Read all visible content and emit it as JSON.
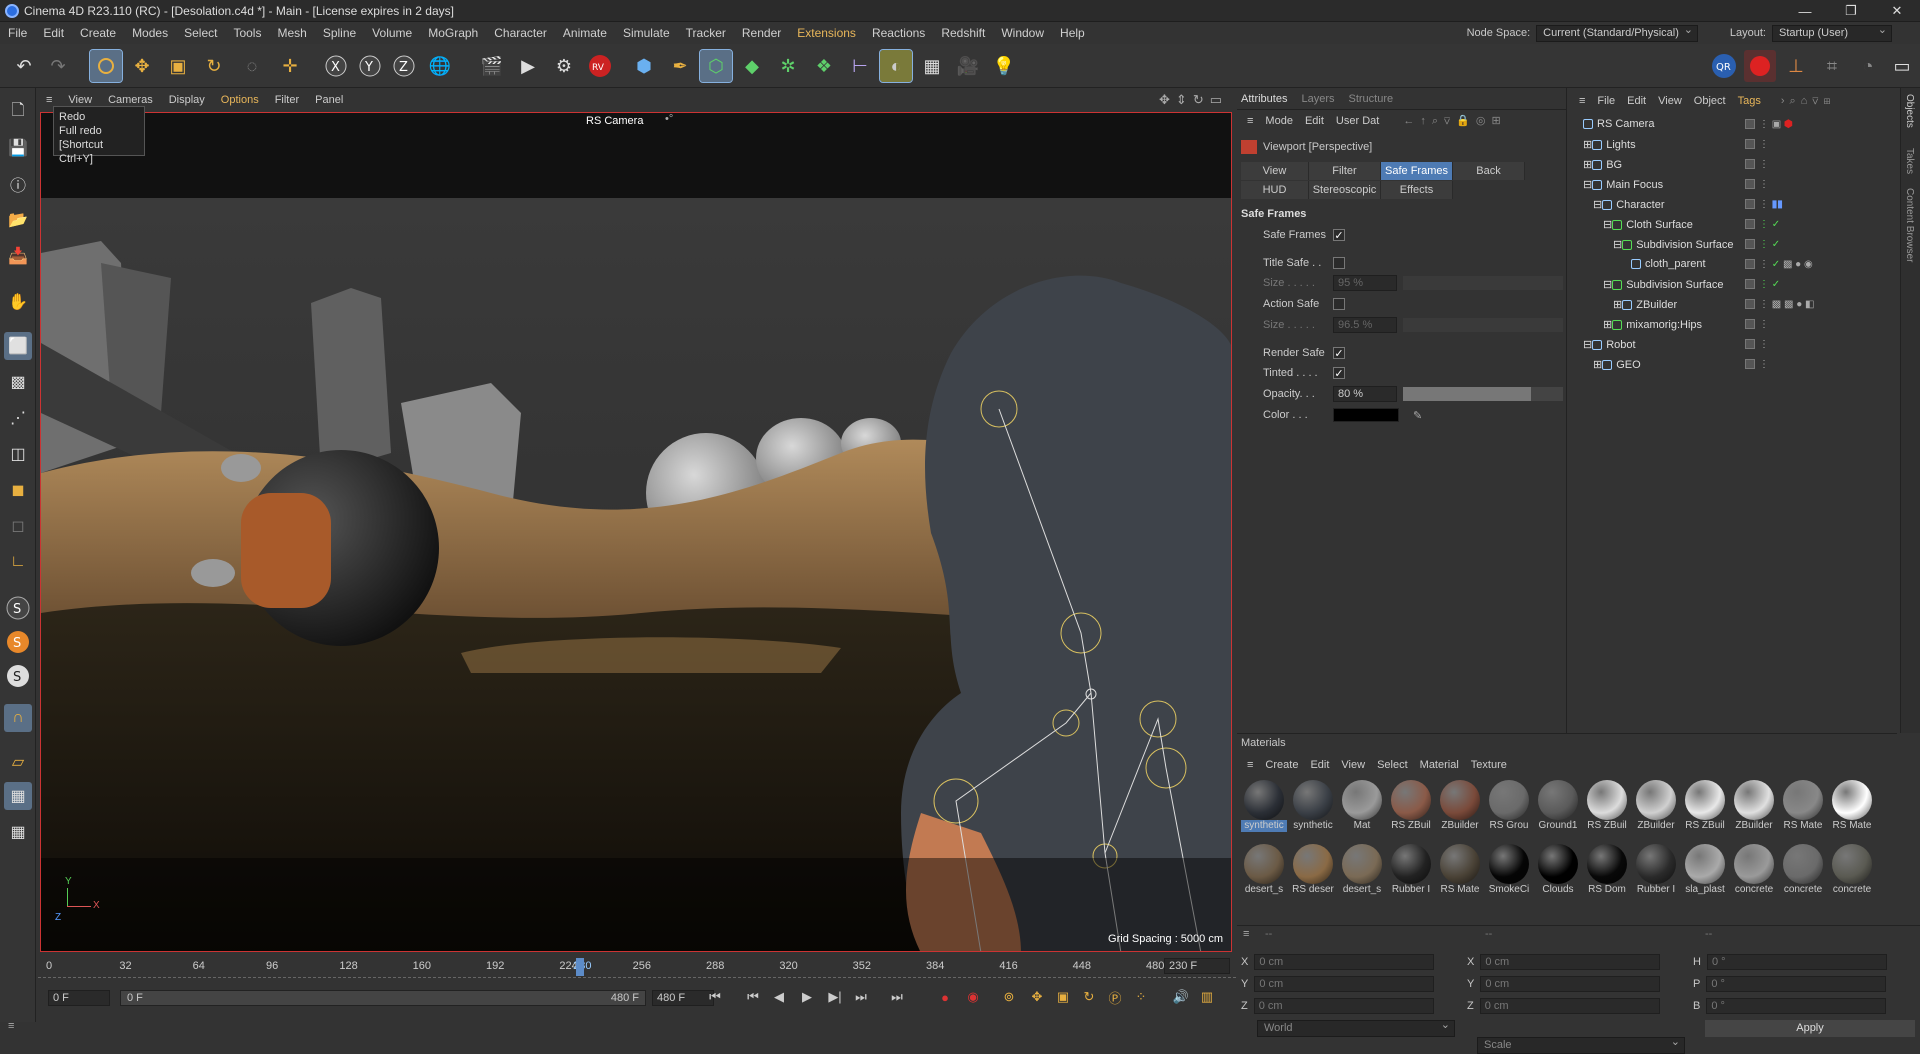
{
  "window": {
    "title": "Cinema 4D R23.110 (RC) - [Desolation.c4d *] - Main - [License expires in 2 days]",
    "controls": [
      "—",
      "❐",
      "✕"
    ]
  },
  "menu": {
    "items": [
      "File",
      "Edit",
      "Create",
      "Modes",
      "Select",
      "Tools",
      "Mesh",
      "Spline",
      "Volume",
      "MoGraph",
      "Character",
      "Animate",
      "Simulate",
      "Tracker",
      "Render",
      "Extensions",
      "Reactions",
      "Redshift",
      "Window",
      "Help"
    ],
    "node_space_label": "Node Space:",
    "node_space_value": "Current (Standard/Physical)",
    "layout_label": "Layout:",
    "layout_value": "Startup (User)"
  },
  "tooltip": {
    "title": "Redo",
    "desc": "Full redo",
    "shortcut": "[Shortcut Ctrl+Y]"
  },
  "viewport": {
    "menu": [
      "View",
      "Cameras",
      "Display",
      "Options",
      "Filter",
      "Panel"
    ],
    "camera_label": "RS Camera",
    "grid_spacing": "Grid Spacing : 5000 cm",
    "axis_y": "Y",
    "axis_x": "X",
    "axis_z": "Z"
  },
  "attributes": {
    "tabs": [
      "Attributes",
      "Layers",
      "Structure"
    ],
    "menu": [
      "Mode",
      "Edit",
      "User Dat"
    ],
    "title": "Viewport [Perspective]",
    "buttons_row1": [
      "View",
      "Filter",
      "Safe Frames",
      "Back"
    ],
    "buttons_row2": [
      "HUD",
      "Stereoscopic",
      "Effects"
    ],
    "section": "Safe Frames",
    "safe_frames_label": "Safe Frames",
    "title_safe_label": "Title Safe . .",
    "size_label": "Size . . . . .",
    "title_safe_size": "95 %",
    "action_safe_label": "Action Safe",
    "action_safe_size": "96.5 %",
    "render_safe_label": "Render Safe",
    "tinted_label": "Tinted . . . .",
    "opacity_label": "Opacity. . .",
    "opacity_value": "80 %",
    "opacity_fraction": 0.8,
    "color_label": "Color . . ."
  },
  "objects": {
    "menu": [
      "File",
      "Edit",
      "View",
      "Object",
      "Tags"
    ],
    "items": [
      {
        "name": "RS Camera"
      },
      {
        "name": "Lights"
      },
      {
        "name": "BG"
      },
      {
        "name": "Main Focus"
      },
      {
        "name": "Character"
      },
      {
        "name": "Cloth Surface"
      },
      {
        "name": "Subdivision Surface"
      },
      {
        "name": "cloth_parent"
      },
      {
        "name": "Subdivision Surface"
      },
      {
        "name": "ZBuilder"
      },
      {
        "name": "mixamorig:Hips"
      },
      {
        "name": "Robot"
      },
      {
        "name": "GEO"
      }
    ],
    "side_tabs": [
      "Objects",
      "Takes",
      "Content Browser"
    ]
  },
  "materials": {
    "header": "Materials",
    "menu": [
      "Create",
      "Edit",
      "View",
      "Select",
      "Material",
      "Texture"
    ],
    "row1": [
      {
        "name": "synthetic",
        "color": "#2b2f36"
      },
      {
        "name": "synthetic",
        "color": "#3a3f46"
      },
      {
        "name": "Mat",
        "color": "#9a9a9a"
      },
      {
        "name": "RS ZBuil",
        "color": "#8a5a48"
      },
      {
        "name": "ZBuilder",
        "color": "#7a4a3a"
      },
      {
        "name": "RS Grou",
        "color": "#6a6a6a"
      },
      {
        "name": "Ground1",
        "color": "#5a5a5a"
      },
      {
        "name": "RS ZBuil",
        "color": "#dcdcdc"
      },
      {
        "name": "ZBuilder",
        "color": "#d0d0d0"
      },
      {
        "name": "RS ZBuil",
        "color": "#e8e8e8"
      },
      {
        "name": "ZBuilder",
        "color": "#e0e0e0"
      },
      {
        "name": "RS Mate",
        "color": "#888888"
      },
      {
        "name": "RS Mate",
        "color": "#ffffff"
      }
    ],
    "row2": [
      {
        "name": "desert_s",
        "color": "#6b5a45"
      },
      {
        "name": "RS deser",
        "color": "#8a6a45"
      },
      {
        "name": "desert_s",
        "color": "#7a6a55"
      },
      {
        "name": "Rubber I",
        "color": "#222222"
      },
      {
        "name": "RS Mate",
        "color": "#4a4236"
      },
      {
        "name": "SmokeCi",
        "color": "#050505"
      },
      {
        "name": "Clouds",
        "color": "#000000"
      },
      {
        "name": "RS Dom",
        "color": "#080808"
      },
      {
        "name": "Rubber I",
        "color": "#2a2a2a"
      },
      {
        "name": "sla_plast",
        "color": "#aaaaaa"
      },
      {
        "name": "concrete",
        "color": "#9a9a9a"
      },
      {
        "name": "concrete",
        "color": "#6a6a6a"
      },
      {
        "name": "concrete",
        "color": "#5a5a52"
      }
    ]
  },
  "coords": {
    "rows": [
      {
        "a": "X",
        "av": "0 cm",
        "b": "X",
        "bv": "0 cm",
        "c": "H",
        "cv": "0 °"
      },
      {
        "a": "Y",
        "av": "0 cm",
        "b": "Y",
        "bv": "0 cm",
        "c": "P",
        "cv": "0 °"
      },
      {
        "a": "Z",
        "av": "0 cm",
        "b": "Z",
        "bv": "0 cm",
        "c": "B",
        "cv": "0 °"
      }
    ],
    "dash": "--",
    "world": "World",
    "scale": "Scale",
    "apply": "Apply"
  },
  "timeline": {
    "ticks": [
      "0",
      "32",
      "64",
      "96",
      "128",
      "160",
      "192",
      "224",
      "230",
      "256",
      "288",
      "320",
      "352",
      "384",
      "416",
      "448",
      "480"
    ],
    "current_frame": "230 F",
    "start": "0 F",
    "range_start": "0 F",
    "range_end": "480 F",
    "end": "480 F"
  }
}
